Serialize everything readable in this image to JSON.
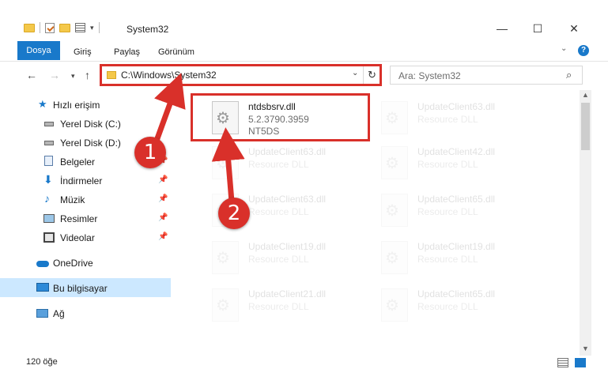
{
  "window": {
    "title": "System32"
  },
  "ribbon": {
    "tabs": [
      "Dosya",
      "Giriş",
      "Paylaş",
      "Görünüm"
    ]
  },
  "address": {
    "path": "C:\\Windows\\System32"
  },
  "search": {
    "placeholder": "Ara: System32"
  },
  "sidebar": {
    "items": [
      {
        "label": "Hızlı erişim",
        "icon": "star-icon",
        "pinned": false
      },
      {
        "label": "Yerel Disk (C:)",
        "icon": "drive-icon",
        "pinned": false
      },
      {
        "label": "Yerel Disk (D:)",
        "icon": "drive-icon",
        "pinned": false
      },
      {
        "label": "Belgeler",
        "icon": "documents-icon",
        "pinned": true
      },
      {
        "label": "İndirmeler",
        "icon": "downloads-icon",
        "pinned": true
      },
      {
        "label": "Müzik",
        "icon": "music-icon",
        "pinned": true
      },
      {
        "label": "Resimler",
        "icon": "pictures-icon",
        "pinned": true
      },
      {
        "label": "Videolar",
        "icon": "videos-icon",
        "pinned": true
      },
      {
        "label": "OneDrive",
        "icon": "cloud-icon",
        "pinned": false
      },
      {
        "label": "Bu bilgisayar",
        "icon": "computer-icon",
        "pinned": false,
        "selected": true
      },
      {
        "label": "Ağ",
        "icon": "network-icon",
        "pinned": false
      }
    ]
  },
  "files": {
    "main": {
      "name": "ntdsbsrv.dll",
      "version": "5.2.3790.3959",
      "description": "NT5DS"
    },
    "faded": [
      {
        "name": "UpdateClient63.dll",
        "description": "Resource DLL"
      },
      {
        "name": "UpdateClient63.dll",
        "description": "Resource DLL"
      },
      {
        "name": "UpdateClient42.dll",
        "description": "Resource DLL"
      },
      {
        "name": "UpdateClient63.dll",
        "description": "Resource DLL"
      },
      {
        "name": "UpdateClient65.dll",
        "description": "Resource DLL"
      },
      {
        "name": "UpdateClient19.dll",
        "description": "Resource DLL"
      },
      {
        "name": "UpdateClient19.dll",
        "description": "Resource DLL"
      },
      {
        "name": "UpdateClient21.dll",
        "description": "Resource DLL"
      },
      {
        "name": "UpdateClient65.dll",
        "description": "Resource DLL"
      }
    ]
  },
  "status": {
    "count": "120 öğe"
  },
  "callouts": [
    "1",
    "2"
  ],
  "colors": {
    "accent": "#1979ca",
    "highlight": "#d9302a",
    "selected": "#cce8ff"
  }
}
